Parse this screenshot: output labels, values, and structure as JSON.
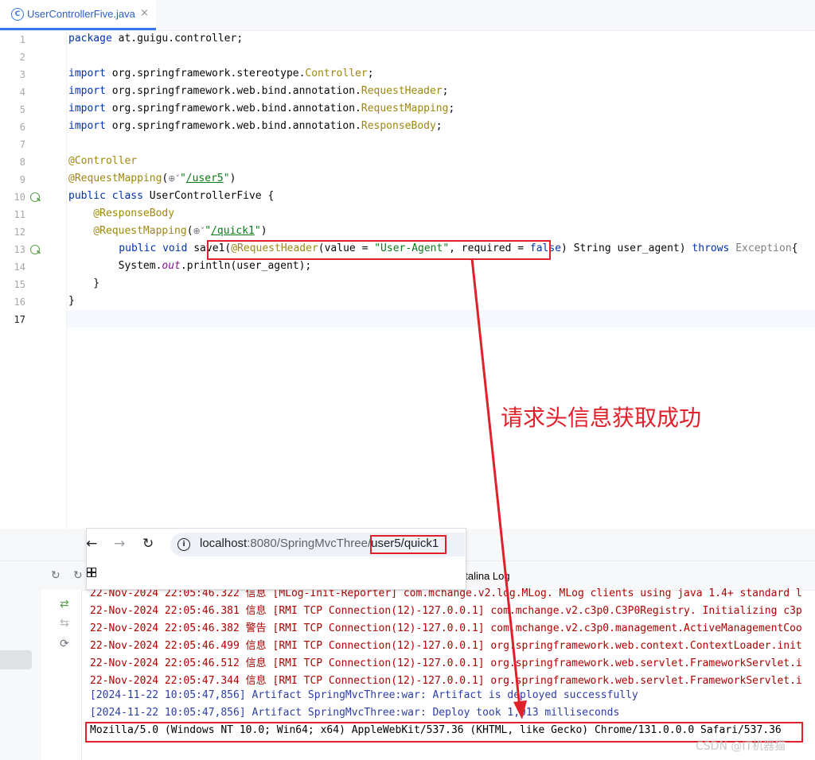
{
  "tab": {
    "title": "UserControllerFive.java",
    "close": "×",
    "icon": "class-icon"
  },
  "editor": {
    "lines": [
      {
        "n": "1"
      },
      {
        "n": "2"
      },
      {
        "n": "3"
      },
      {
        "n": "4"
      },
      {
        "n": "5"
      },
      {
        "n": "6"
      },
      {
        "n": "7"
      },
      {
        "n": "8"
      },
      {
        "n": "9"
      },
      {
        "n": "10"
      },
      {
        "n": "11"
      },
      {
        "n": "12"
      },
      {
        "n": "13"
      },
      {
        "n": "14"
      },
      {
        "n": "15"
      },
      {
        "n": "16"
      },
      {
        "n": "17"
      }
    ],
    "code": {
      "l1_kw": "package",
      "l1_rest": " at.guigu.controller;",
      "l3_kw": "import",
      "l3_pkg": " org.springframework.stereotype.",
      "l3_cls": "Controller",
      "l3_end": ";",
      "l4_kw": "import",
      "l4_pkg": " org.springframework.web.bind.annotation.",
      "l4_cls": "RequestHeader",
      "l4_end": ";",
      "l5_kw": "import",
      "l5_pkg": " org.springframework.web.bind.annotation.",
      "l5_cls": "RequestMapping",
      "l5_end": ";",
      "l6_kw": "import",
      "l6_pkg": " org.springframework.web.bind.annotation.",
      "l6_cls": "ResponseBody",
      "l6_end": ";",
      "l8_ann": "@Controller",
      "l9_ann": "@RequestMapping",
      "l9_open": "(",
      "l9_globe": "⊕˅",
      "l9_q1": "\"",
      "l9_link": "/user5",
      "l9_q2": "\"",
      "l9_close": ")",
      "l10_kw": "public class",
      "l10_rest": " UserControllerFive {",
      "l11_ann": "    @ResponseBody",
      "l12_ann": "    @RequestMapping",
      "l12_open": "(",
      "l12_globe": "⊕˅",
      "l12_q1": "\"",
      "l12_link": "/quick1",
      "l12_q2": "\"",
      "l12_close": ")",
      "l13_kw": "    public void",
      "l13_m": " save1(",
      "l13_ann": "@RequestHeader",
      "l13_a": "(value = ",
      "l13_s": "\"User-Agent\"",
      "l13_b": ", required = ",
      "l13_f": "false",
      "l13_c": ") String user_agent) ",
      "l13_throws": "throws",
      "l13_ex": " Exception",
      "l13_d": "{",
      "l14_a": "        System.",
      "l14_out": "out",
      "l14_b": ".println(user_agent);",
      "l15": "    }",
      "l16": "}"
    }
  },
  "browser": {
    "back": "←",
    "forward": "→",
    "reload": "↻",
    "url_host": "localhost",
    "url_rest": ":8080/SpringMvcThree/",
    "url_path": "user5/quick1"
  },
  "panel": {
    "catalina_tab": "atalina Log",
    "logs": [
      {
        "text": "22-Nov-2024 22:05:46.322 信息 [MLog-Init-Reporter] com.mchange.v2.log.MLog. MLog clients using java 1.4+ standard l",
        "color": "red"
      },
      {
        "text": "22-Nov-2024 22:05:46.381 信息 [RMI TCP Connection(12)-127.0.0.1] com.mchange.v2.c3p0.C3P0Registry. Initializing c3p",
        "color": "red"
      },
      {
        "text": "22-Nov-2024 22:05:46.382 警告 [RMI TCP Connection(12)-127.0.0.1] com.mchange.v2.c3p0.management.ActiveManagementCoo",
        "color": "red"
      },
      {
        "text": "22-Nov-2024 22:05:46.499 信息 [RMI TCP Connection(12)-127.0.0.1] org.springframework.web.context.ContextLoader.init",
        "color": "red"
      },
      {
        "text": "22-Nov-2024 22:05:46.512 信息 [RMI TCP Connection(12)-127.0.0.1] org.springframework.web.servlet.FrameworkServlet.i",
        "color": "red"
      },
      {
        "text": "22-Nov-2024 22:05:47.344 信息 [RMI TCP Connection(12)-127.0.0.1] org.springframework.web.servlet.FrameworkServlet.i",
        "color": "red"
      },
      {
        "text": "[2024-11-22 10:05:47,856] Artifact SpringMvcThree:war: Artifact is deployed successfully",
        "color": "blue"
      },
      {
        "text": "[2024-11-22 10:05:47,856] Artifact SpringMvcThree:war: Deploy took 1,013 milliseconds",
        "color": "blue"
      },
      {
        "text": "Mozilla/5.0 (Windows NT 10.0; Win64; x64) AppleWebKit/537.36 (KHTML, like Gecko) Chrome/131.0.0.0 Safari/537.36",
        "color": "black"
      }
    ]
  },
  "annotation": {
    "text": "请求头信息获取成功",
    "color": "#e0202a"
  },
  "watermark": "CSDN @IT机器猫"
}
